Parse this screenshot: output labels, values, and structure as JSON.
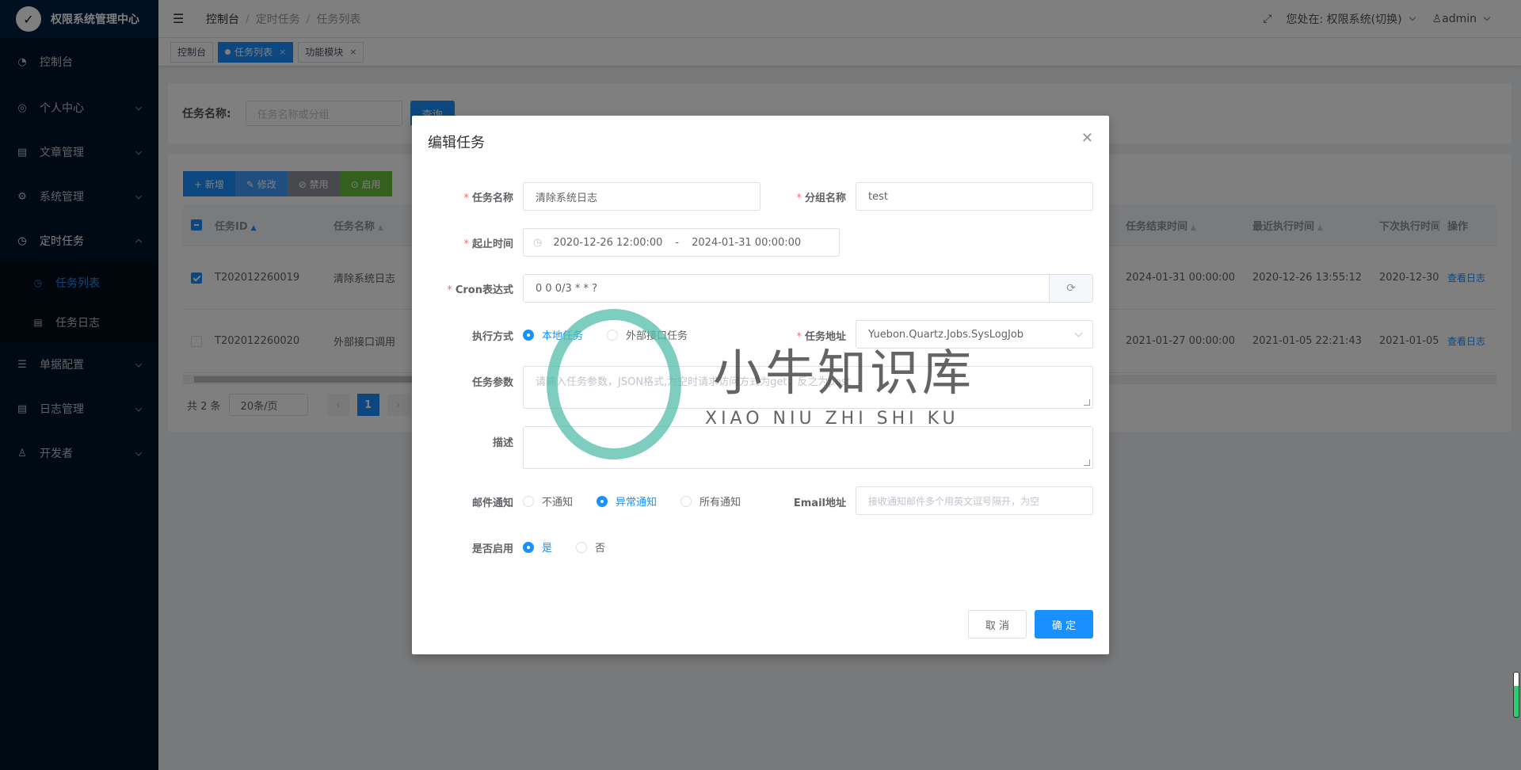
{
  "app": {
    "title": "权限系统管理中心"
  },
  "sidebar": {
    "items": [
      {
        "label": "控制台",
        "icon": "dashboard-icon"
      },
      {
        "label": "个人中心",
        "icon": "user-circle-icon"
      },
      {
        "label": "文章管理",
        "icon": "article-icon"
      },
      {
        "label": "系统管理",
        "icon": "gear-icon"
      },
      {
        "label": "定时任务",
        "icon": "clock-icon"
      },
      {
        "label": "单据配置",
        "icon": "sliders-icon"
      },
      {
        "label": "日志管理",
        "icon": "log-icon"
      },
      {
        "label": "开发者",
        "icon": "developer-icon"
      }
    ],
    "sub": [
      {
        "label": "任务列表",
        "icon": "clock-icon"
      },
      {
        "label": "任务日志",
        "icon": "log-icon"
      }
    ]
  },
  "header": {
    "breadcrumb": [
      "控制台",
      "定时任务",
      "任务列表"
    ],
    "location": "您处在: 权限系统(切换)",
    "user": "admin"
  },
  "tags": [
    {
      "label": "控制台"
    },
    {
      "label": "任务列表"
    },
    {
      "label": "功能模块"
    }
  ],
  "search": {
    "label": "任务名称:",
    "placeholder": "任务名称或分组",
    "button": "查询"
  },
  "toolbar": {
    "add": "+ 新增",
    "edit": "✎ 修改",
    "disable": "⊘ 禁用",
    "enable": "⊙ 启用"
  },
  "table": {
    "headers": [
      "任务ID",
      "任务名称",
      "任务结束时间",
      "最近执行时间",
      "下次执行时间",
      "操作"
    ],
    "rows": [
      {
        "id": "T202012260019",
        "name": "清除系统日志",
        "end": "2024-01-31 00:00:00",
        "last": "2020-12-26 13:55:12",
        "next": "2020-12-30",
        "action": "查看日志"
      },
      {
        "id": "T202012260020",
        "name": "外部接口调用",
        "end": "2021-01-27 00:00:00",
        "last": "2021-01-05 22:21:43",
        "next": "2021-01-05",
        "action": "查看日志"
      }
    ]
  },
  "pager": {
    "total": "共 2 条",
    "size": "20条/页",
    "page": "1"
  },
  "modal": {
    "title": "编辑任务",
    "name_label": "任务名称",
    "name_value": "清除系统日志",
    "group_label": "分组名称",
    "group_value": "test",
    "time_label": "起止时间",
    "time_start": "2020-12-26 12:00:00",
    "time_sep": "-",
    "time_end": "2024-01-31 00:00:00",
    "cron_label": "Cron表达式",
    "cron_value": "0 0 0/3 * * ?",
    "mode_label": "执行方式",
    "mode_local": "本地任务",
    "mode_remote": "外部接口任务",
    "addr_label": "任务地址",
    "addr_value": "Yuebon.Quartz.Jobs.SysLogJob",
    "params_label": "任务参数",
    "params_placeholder": "请输入任务参数，JSON格式,为空时请求访问方式为get，反之为post",
    "desc_label": "描述",
    "mail_label": "邮件通知",
    "mail_none": "不通知",
    "mail_error": "异常通知",
    "mail_all": "所有通知",
    "email_label": "Email地址",
    "email_placeholder": "接收通知邮件多个用英文逗号隔开，为空",
    "enable_label": "是否启用",
    "enable_yes": "是",
    "enable_no": "否",
    "cancel": "取 消",
    "ok": "确 定"
  },
  "watermark": {
    "cn": "小牛知识库",
    "en": "XIAO NIU ZHI SHI KU"
  },
  "colors": {
    "primary": "#1890ff",
    "sidebar": "#001529",
    "danger": "#f56c6c"
  }
}
